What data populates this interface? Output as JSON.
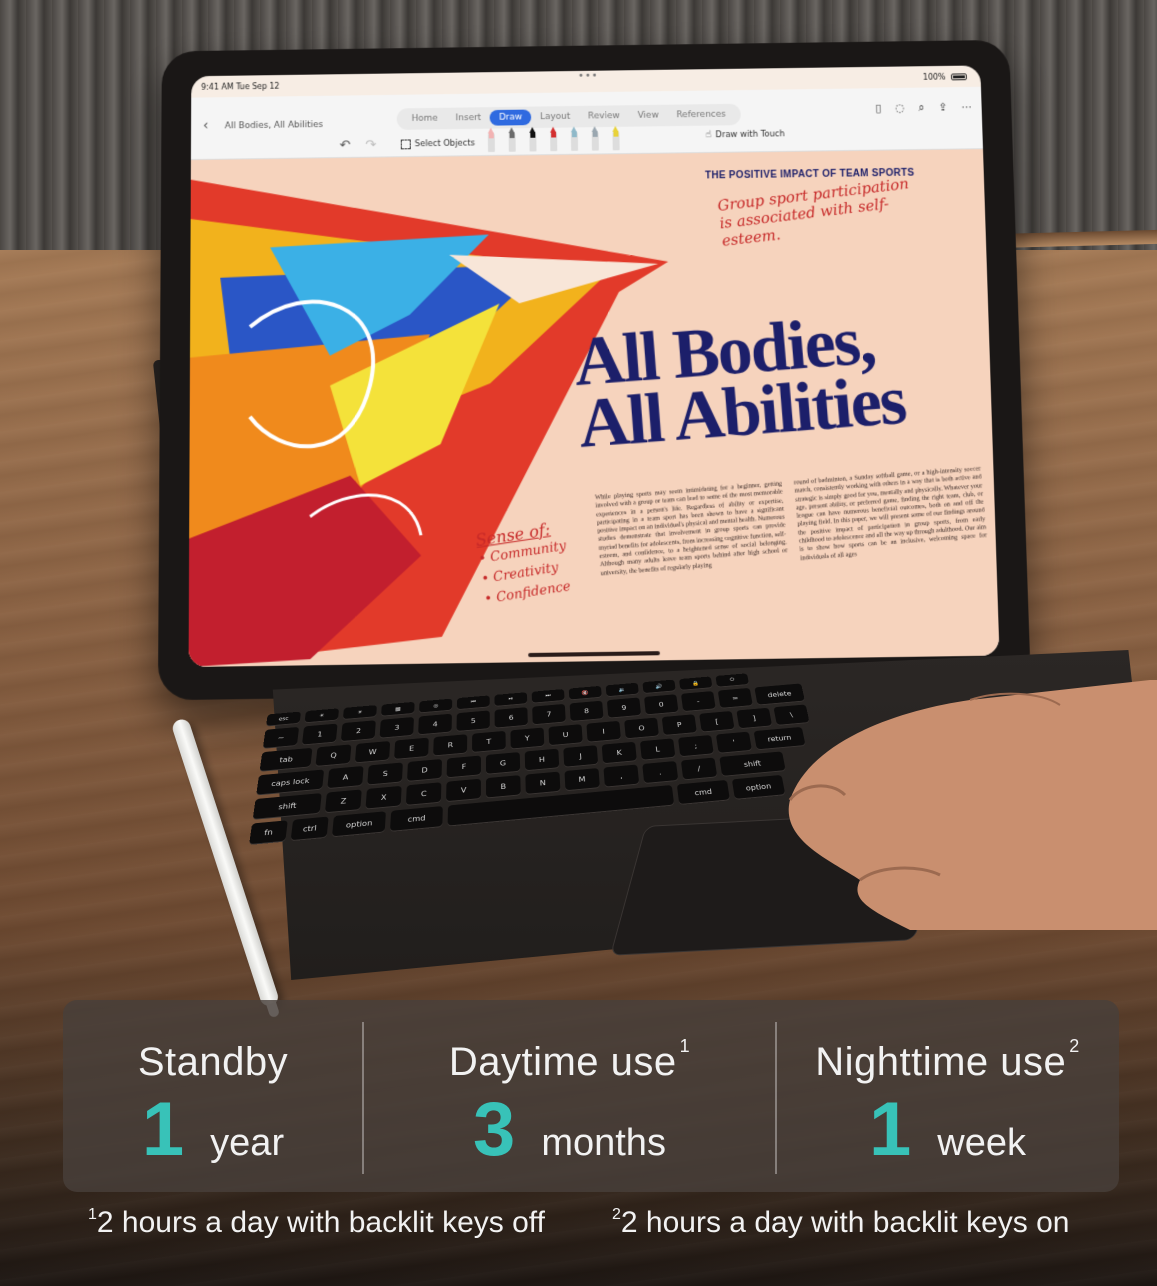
{
  "tablet": {
    "status": {
      "time": "9:41 AM  Tue Sep 12",
      "battery": "100%",
      "dots": "•••"
    },
    "document_title": "All Bodies, All Abilities",
    "tabs": [
      {
        "label": "Home"
      },
      {
        "label": "Insert"
      },
      {
        "label": "Draw"
      },
      {
        "label": "Layout"
      },
      {
        "label": "Review"
      },
      {
        "label": "View"
      },
      {
        "label": "References"
      }
    ],
    "active_tab": "Draw",
    "select_objects": "Select Objects",
    "draw_with_touch": "Draw with Touch",
    "pen_colors": [
      "#f2b3b3",
      "#6b6b6b",
      "#111111",
      "#d32f2f",
      "#8fb9c9",
      "#9aa7b0",
      "#e8d23a"
    ],
    "doc": {
      "kicker": "THE POSITIVE IMPACT OF TEAM SPORTS",
      "handnote_top": "Group sport participation is associated with self-esteem.",
      "headline_1": "All Bodies,",
      "headline_2": "All Abilities",
      "col1": "While playing sports may seem intimidating for a beginner, getting involved with a group or team can lead to some of the most memorable experiences in a person's life. Regardless of ability or expertise, participating in a team sport has been shown to have a significant positive impact on an individual's physical and mental health. Numerous studies demonstrate that involvement in group sports can provide myriad benefits for adolescents, from increasing cognitive function, self-esteem, and confidence, to a heightened sense of social belonging. Although many adults leave team sports behind after high school or university, the benefits of regularly playing",
      "col2": "round of badminton, a Sunday softball game, or a high-intensity soccer match, consistently working with others in a way that is both active and strategic is simply good for you, mentally and physically. Whatever your age, present ability, or preferred game, finding the right team, club, or league can have numerous beneficial outcomes, both on and off the playing field. In this paper, we will present some of our findings around the positive impact of participation in group sports, from early childhood to adolescence and all the way up through adulthood. Our aim is to show how sports can be an inclusive, welcoming space for individuals of all ages",
      "handnote_side_heading": "Sense of:",
      "handnote_side_items": [
        "• Community",
        "• Creativity",
        "• Confidence"
      ]
    }
  },
  "keyboard": {
    "rows": [
      [
        "esc",
        "☀",
        "☀",
        "▦",
        "◎",
        "⏮",
        "⏯",
        "⏭",
        "🔇",
        "🔉",
        "🔊",
        "🔒",
        "⏻"
      ],
      [
        "~",
        "1",
        "2",
        "3",
        "4",
        "5",
        "6",
        "7",
        "8",
        "9",
        "0",
        "-",
        "=",
        "delete"
      ],
      [
        "tab",
        "Q",
        "W",
        "E",
        "R",
        "T",
        "Y",
        "U",
        "I",
        "O",
        "P",
        "[",
        "]",
        "\\"
      ],
      [
        "caps lock",
        "A",
        "S",
        "D",
        "F",
        "G",
        "H",
        "J",
        "K",
        "L",
        ";",
        "'",
        "return"
      ],
      [
        "shift",
        "Z",
        "X",
        "C",
        "V",
        "B",
        "N",
        "M",
        ",",
        ".",
        "/",
        "shift"
      ],
      [
        "fn",
        "ctrl",
        "option",
        "cmd",
        "",
        "cmd",
        "option"
      ]
    ]
  },
  "panel": {
    "stats": [
      {
        "title": "Standby",
        "sup": "",
        "number": "1",
        "unit": "year"
      },
      {
        "title": "Daytime use",
        "sup": "1",
        "number": "3",
        "unit": "months"
      },
      {
        "title": "Nighttime use",
        "sup": "2",
        "number": "1",
        "unit": "week"
      }
    ],
    "accent_color": "#38c2b8"
  },
  "footnotes": [
    {
      "sup": "1",
      "text": "2 hours a day with backlit keys off"
    },
    {
      "sup": "2",
      "text": "2 hours a day with backlit keys on"
    }
  ]
}
